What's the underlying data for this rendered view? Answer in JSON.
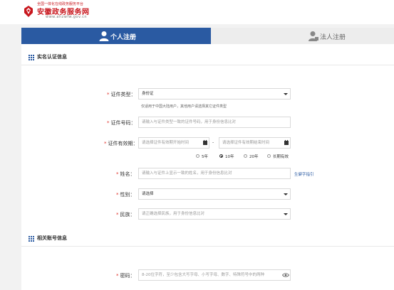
{
  "site": {
    "tagline": "全国一体化在线政务服务平台",
    "name": "安徽政务服务网",
    "domain": "www.ahzwfw.gov.cn"
  },
  "tabs": {
    "personal": "个人注册",
    "legal": "法人注册"
  },
  "sections": {
    "realname": "实名认证信息",
    "account": "相关账号信息"
  },
  "form": {
    "id_type": {
      "label": "证件类型：",
      "value": "身份证",
      "hint": "仅适用于中国大陆用户，其他用户请选择其它证件类型"
    },
    "id_number": {
      "label": "证件号码：",
      "placeholder": "请输入与证件类型一致的证件号码，用于身份信息比对"
    },
    "validity": {
      "label": "证件有效期：",
      "start_placeholder": "请选择证件有效期开始时间",
      "end_placeholder": "请选择证件有效期结束时间",
      "separator": "-",
      "options": [
        "5年",
        "10年",
        "20年",
        "长期有效"
      ],
      "selected": "10年"
    },
    "name": {
      "label": "姓名：",
      "placeholder": "请输入与证件上显示一致的姓名，用于身份信息比对",
      "rare_char_link": "生僻字指引"
    },
    "gender": {
      "label": "性别：",
      "value": "请选择"
    },
    "ethnicity": {
      "label": "民族：",
      "placeholder": "请正确选择民族，用于身份信息比对"
    },
    "password": {
      "label": "密码：",
      "placeholder": "8-20位字符，至少包含大写字母、小写字母、数字、特殊符号中的两种"
    }
  },
  "colors": {
    "brand": "#c8161d",
    "tab_active": "#2a5aa2",
    "required": "#e0322a"
  }
}
